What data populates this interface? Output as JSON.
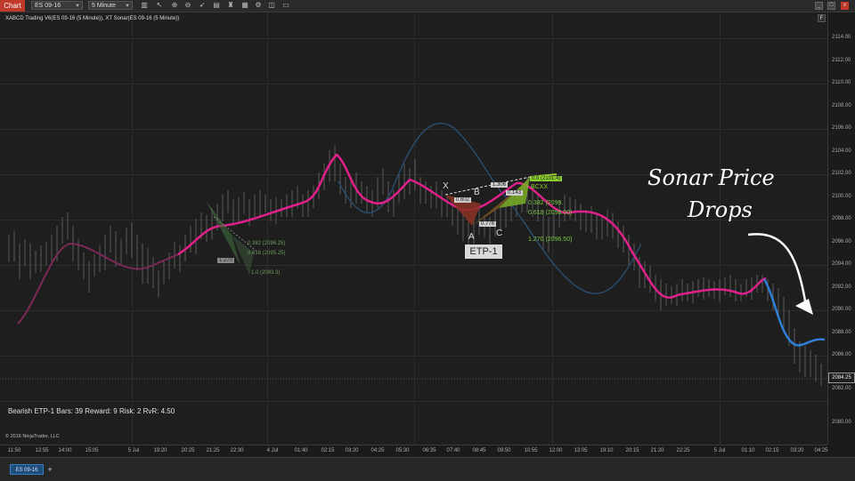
{
  "toolbar": {
    "chart_label": "Chart",
    "instrument": "ES 09-16",
    "interval": "5 Minute",
    "icons": [
      "bar-type-icon",
      "pointer-icon",
      "draw-icon",
      "zoom-in-icon",
      "zoom-out-icon",
      "cursor-icon",
      "data-box-icon",
      "strategies-icon",
      "indicators-icon",
      "properties-icon",
      "lock-icon",
      "add-window-icon",
      "more-icon"
    ]
  },
  "window": {
    "minimize": "_",
    "maximize": "□",
    "close": "x"
  },
  "chart": {
    "title": "XABCD Trading V6(ES 09-16 (5 Minute)), XT Sonar(ES 09-16 (5 Minute))",
    "f_button": "F",
    "stats": "Bearish ETP-1  Bars: 39  Reward: 9  Risk: 2  RvR: 4.50",
    "copyright": "© 2016 NinjaTrader, LLC",
    "current_price": "2084.25",
    "price_axis": [
      "2114.00",
      "2112.00",
      "2110.00",
      "2108.00",
      "2106.00",
      "2104.00",
      "2102.00",
      "2100.00",
      "2098.00",
      "2096.00",
      "2094.00",
      "2092.00",
      "2090.00",
      "2088.00",
      "2086.00",
      "2084.00",
      "2082.00",
      "2080.00"
    ],
    "time_axis": [
      "11:50",
      "12:55",
      "14:00",
      "15:05",
      "5 Jul",
      "18:15",
      "19:20",
      "20:25",
      "21:25",
      "22:30",
      "23:35",
      "4 Jul",
      "01:40",
      "02:15",
      "03:20",
      "04:25",
      "05:30",
      "06:35",
      "07:40",
      "08:45",
      "09:50",
      "10:55",
      "12:00",
      "13:05",
      "19:10",
      "20:15",
      "21:20",
      "22:25",
      "23:30",
      "5 Jul",
      "01:10",
      "02:15",
      "03:20",
      "04:25"
    ],
    "pattern": {
      "name": "ETP-1",
      "points": {
        "x": "X",
        "a": "A",
        "b": "B",
        "c": "C"
      },
      "ratios": [
        "1.306",
        "0.602",
        "0.778",
        "0.143",
        "0.382 (2099.",
        "0.618 (2098.00)",
        "1.270 (2096.50)",
        "0.0 (2101.4)",
        "BCXX"
      ],
      "left_ratios": [
        "0.382 (2096.25)",
        "0.618 (2095.25)",
        "1.270",
        "1.0 (2093.3)"
      ]
    },
    "annotation": {
      "line1": "Sonar Price",
      "line2": "Drops"
    },
    "colors": {
      "price_line": "#e0208a",
      "sonar_line": "#2f6fc7",
      "sonar_line_dim": "#2a4a6a",
      "pattern_red": "#a83a2a",
      "pattern_green": "#8ccc2a"
    }
  },
  "tabs": {
    "active": "ES 09-16",
    "add": "+"
  }
}
